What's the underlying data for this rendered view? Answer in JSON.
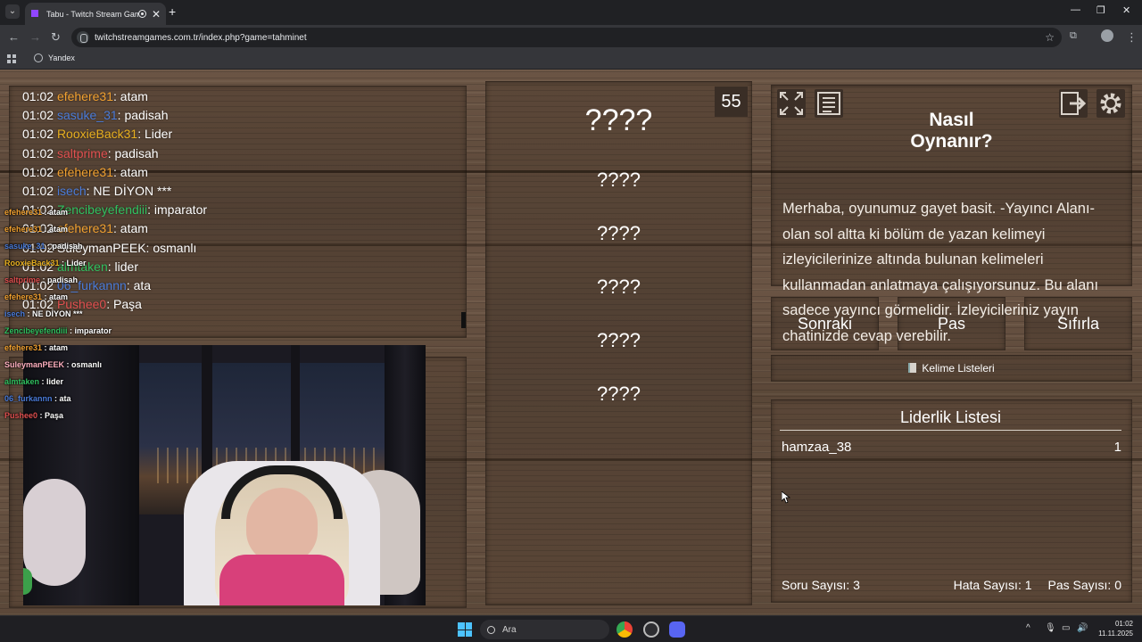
{
  "browser": {
    "tab_title": "Tabu - Twitch Stream Game",
    "url": "twitchstreamgames.com.tr/index.php?game=tahminet",
    "bookmark": "Yandex"
  },
  "chat": [
    {
      "time": "01:02",
      "user": "efehere31",
      "color": "#f0a030",
      "msg": "atam"
    },
    {
      "time": "01:02",
      "user": "sasuke_31",
      "color": "#4a7bd8",
      "msg": "padisah"
    },
    {
      "time": "01:02",
      "user": "RooxieBack31",
      "color": "#e8b020",
      "msg": "Lider"
    },
    {
      "time": "01:02",
      "user": "saltprime",
      "color": "#e05050",
      "msg": "padisah"
    },
    {
      "time": "01:02",
      "user": "efehere31",
      "color": "#f0a030",
      "msg": "atam"
    },
    {
      "time": "01:02",
      "user": "isech",
      "color": "#4a7bd8",
      "msg": "NE DİYON ***"
    },
    {
      "time": "01:02",
      "user": "Zencibeyefendiii",
      "color": "#30c060",
      "msg": "imparator"
    },
    {
      "time": "01:02",
      "user": "efehere31",
      "color": "#f0a030",
      "msg": "atam"
    },
    {
      "time": "01:02",
      "user": "SuleymanPEEK",
      "color": "#ffffff",
      "msg": "osmanlı"
    },
    {
      "time": "01:02",
      "user": "almtaken",
      "color": "#30c060",
      "msg": "lider"
    },
    {
      "time": "01:02",
      "user": "06_furkannn",
      "color": "#4a7bd8",
      "msg": "ata"
    },
    {
      "time": "01:02",
      "user": "Pushee0",
      "color": "#e05050",
      "msg": "Paşa"
    }
  ],
  "overlay_chat": [
    {
      "user": "efehere31",
      "color": "#f0a030",
      "msg": "atam"
    },
    {
      "user": "efehere31",
      "color": "#f0a030",
      "msg": "atam"
    },
    {
      "user": "sasuke_31",
      "color": "#4a7bd8",
      "msg": "padisah"
    },
    {
      "user": "RooxieBack31",
      "color": "#e8b020",
      "msg": "Lider"
    },
    {
      "user": "saltprime",
      "color": "#e05050",
      "msg": "padisah"
    },
    {
      "user": "efehere31",
      "color": "#f0a030",
      "msg": "atam"
    },
    {
      "user": "isech",
      "color": "#4a7bd8",
      "msg": "NE DİYON ***"
    },
    {
      "user": "Zencibeyefendiii",
      "color": "#30c060",
      "msg": "imparator"
    },
    {
      "user": "efehere31",
      "color": "#f0a030",
      "msg": "atam"
    },
    {
      "user": "SuleymanPEEK",
      "color": "#ffb0c0",
      "msg": "osmanlı"
    },
    {
      "user": "almtaken",
      "color": "#30c060",
      "msg": "lider"
    },
    {
      "user": "06_furkannn",
      "color": "#4a7bd8",
      "msg": "ata"
    },
    {
      "user": "Pushee0",
      "color": "#e05050",
      "msg": "Paşa"
    }
  ],
  "game": {
    "timer": "55",
    "main_word": "????",
    "forbidden_words": [
      "????",
      "????",
      "????",
      "????",
      "????"
    ]
  },
  "how_to": {
    "title": "Nasıl Oynanır?",
    "text": "Merhaba, oyunumuz gayet basit. -Yayıncı Alanı- olan sol altta ki bölüm de yazan kelimeyi izleyicilerinize altında bulunan kelimeleri kullanmadan anlatmaya çalışıyorsunuz. Bu alanı sadece yayıncı görmelidir. İzleyicileriniz yayın chatinizde cevap verebilir."
  },
  "buttons": {
    "next": "Sonraki",
    "pass": "Pas",
    "reset": "Sıfırla",
    "word_lists": "Kelime Listeleri"
  },
  "leaderboard": {
    "title": "Liderlik Listesi",
    "rows": [
      {
        "name": "hamzaa_38",
        "score": "1"
      }
    ],
    "question_count": "Soru Sayısı: 3",
    "error_count": "Hata Sayısı: 1",
    "pass_count": "Pas Sayısı: 0"
  },
  "taskbar": {
    "search": "Ara",
    "time": "01:02",
    "date": "11.11.2025"
  }
}
